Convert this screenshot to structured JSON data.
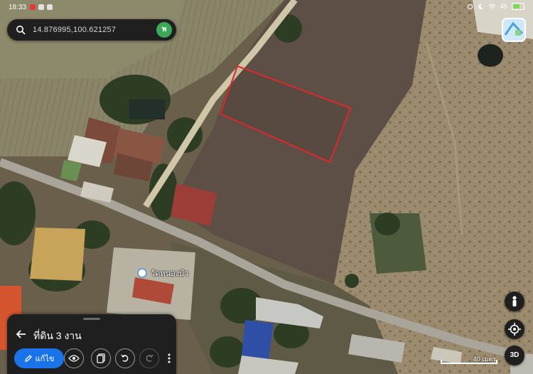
{
  "status_bar": {
    "time": "18:33",
    "battery": "45"
  },
  "search": {
    "query": "14.876995,100.621257",
    "avatar_initial": "พ"
  },
  "poi": {
    "name": "วัดหนองบัว"
  },
  "map_controls": {
    "three_d_label": "3D"
  },
  "scale_bar": {
    "label": "40 เมตร"
  },
  "bottom_sheet": {
    "title": "ที่ดิน 3 งาน",
    "edit_label": "แก้ไข"
  },
  "colors": {
    "boundary": "#e0262b",
    "accent": "#1a73e8",
    "panel": "#1f1f1f",
    "avatar": "#3aa856"
  },
  "icons": [
    "search-icon",
    "layers-icon",
    "pegman-icon",
    "my-location-icon",
    "back-arrow-icon",
    "pencil-icon",
    "eye-icon",
    "copy-icon",
    "undo-icon",
    "redo-icon",
    "more-vert-icon",
    "poi-pin-icon"
  ]
}
